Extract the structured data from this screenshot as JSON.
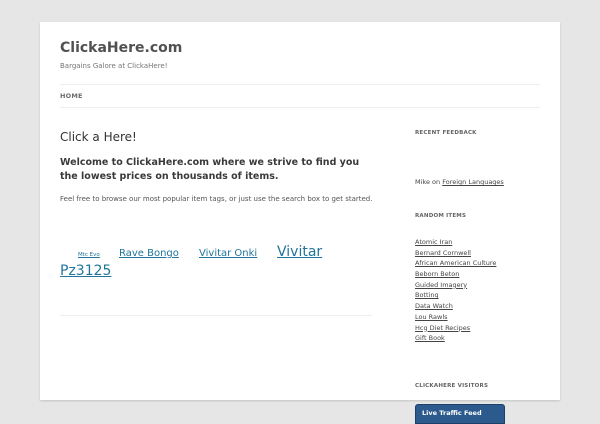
{
  "header": {
    "site_title": "ClickaHere.com",
    "site_description": "Bargains Galore at ClickaHere!"
  },
  "nav": {
    "home": "HOME"
  },
  "main": {
    "title": "Click a Here!",
    "welcome": "Welcome to ClickaHere.com where we strive to find you the lowest prices on thousands of items.",
    "browse": "Feel free to browse our most popular item tags, or just use the search  box to get started.",
    "tags": [
      "Mtc Evo",
      "Rave Bongo",
      "Vivitar Onki",
      "Vivitar Pz3125"
    ]
  },
  "sidebar": {
    "recent_feedback_title": "RECENT FEEDBACK",
    "feedback_author": "Mike",
    "feedback_on": "on",
    "feedback_post": "Foreign Languages",
    "random_items_title": "RANDOM ITEMS",
    "random_items": [
      "Atomic Iran",
      "Bernard Cornwell",
      "African American Culture",
      "Beborn Beton",
      "Guided Imagery",
      "Botting",
      "Data Watch",
      "Lou Rawls",
      "Hcg Diet Recipes",
      "Gift Book"
    ],
    "visitors_title": "CLICKAHERE VISITORS",
    "traffic_feed": "Live Traffic Feed"
  }
}
